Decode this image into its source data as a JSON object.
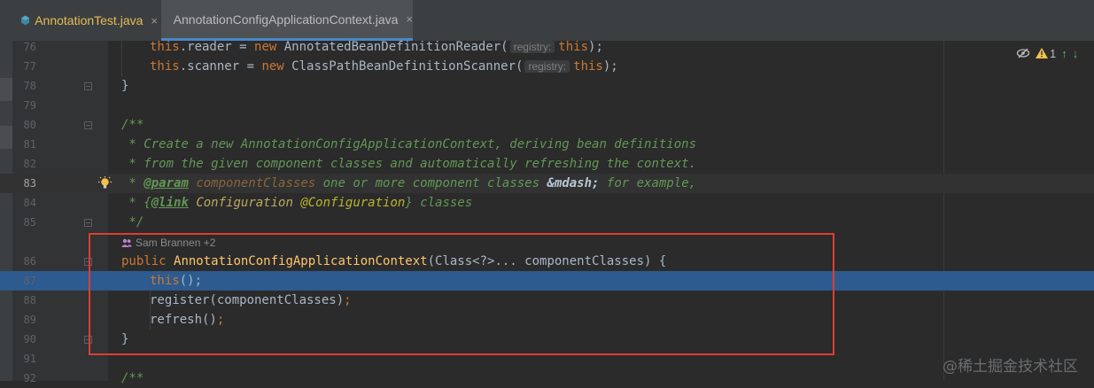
{
  "tabs": [
    {
      "label": "AnnotationTest.java",
      "active": false
    },
    {
      "label": "AnnotationConfigApplicationContext.java",
      "active": true
    }
  ],
  "icons": {
    "java_file": "java-class-icon",
    "close": "×",
    "bulb": "lightbulb-icon",
    "fold": "fold-marker-icon",
    "author": "people-icon",
    "eye": "eye-slash-icon",
    "warning": "warning-triangle-icon",
    "up": "↑",
    "down": "↓"
  },
  "editor": {
    "line_numbers": [
      "76",
      "77",
      "78",
      "79",
      "80",
      "81",
      "82",
      "83",
      "84",
      "85",
      "86",
      "87",
      "88",
      "89",
      "90",
      "91",
      "92"
    ],
    "lines": [
      {
        "l1": "this",
        "l2": ".reader = ",
        "l3": "new ",
        "l4": "AnnotatedBeanDefinitionReader(",
        "hint": "registry:",
        "l5": "this",
        "l6": ");"
      },
      {
        "l1": "this",
        "l2": ".scanner = ",
        "l3": "new ",
        "l4": "ClassPathBeanDefinitionScanner(",
        "hint": "registry:",
        "l5": "this",
        "l6": ");"
      },
      {
        "text": "}"
      },
      {
        "text": ""
      },
      {
        "text": "/**"
      },
      {
        "text": " * Create a new AnnotationConfigApplicationContext, deriving bean definitions"
      },
      {
        "text": " * from the given component classes and automatically refreshing the context."
      },
      {
        "c1": " * ",
        "tag": "@param",
        "c2": " ",
        "param": "componentClasses",
        "c3": " one or more component classes ",
        "ent": "&mdash;",
        "c4": " for example,"
      },
      {
        "c1": " * {",
        "tag": "@link",
        "c2": " ",
        "ref": "Configuration",
        "c3": " ",
        "ann": "@Configuration",
        "c4": "} classes"
      },
      {
        "text": " */"
      },
      {
        "kw": "public ",
        "fn": "AnnotationConfigApplicationContext",
        "rest": "(Class<?>... componentClasses) {"
      },
      {
        "kw": "this",
        "rest": "();"
      },
      {
        "pre": "register(componentClasses)",
        "kw": ";"
      },
      {
        "pre": "refresh()",
        "kw": ";"
      },
      {
        "text": "}"
      },
      {
        "text": ""
      },
      {
        "text": "/**"
      }
    ],
    "author_hint": "Sam Brannen +2",
    "current_line": "83",
    "selected_line": "87"
  },
  "toolbar": {
    "warning_count": "1"
  },
  "colors": {
    "accent": "#4a88c7",
    "selection": "#2d5a8f",
    "highlight_box": "#dd3e30"
  },
  "watermark": "@稀土掘金技术社区"
}
